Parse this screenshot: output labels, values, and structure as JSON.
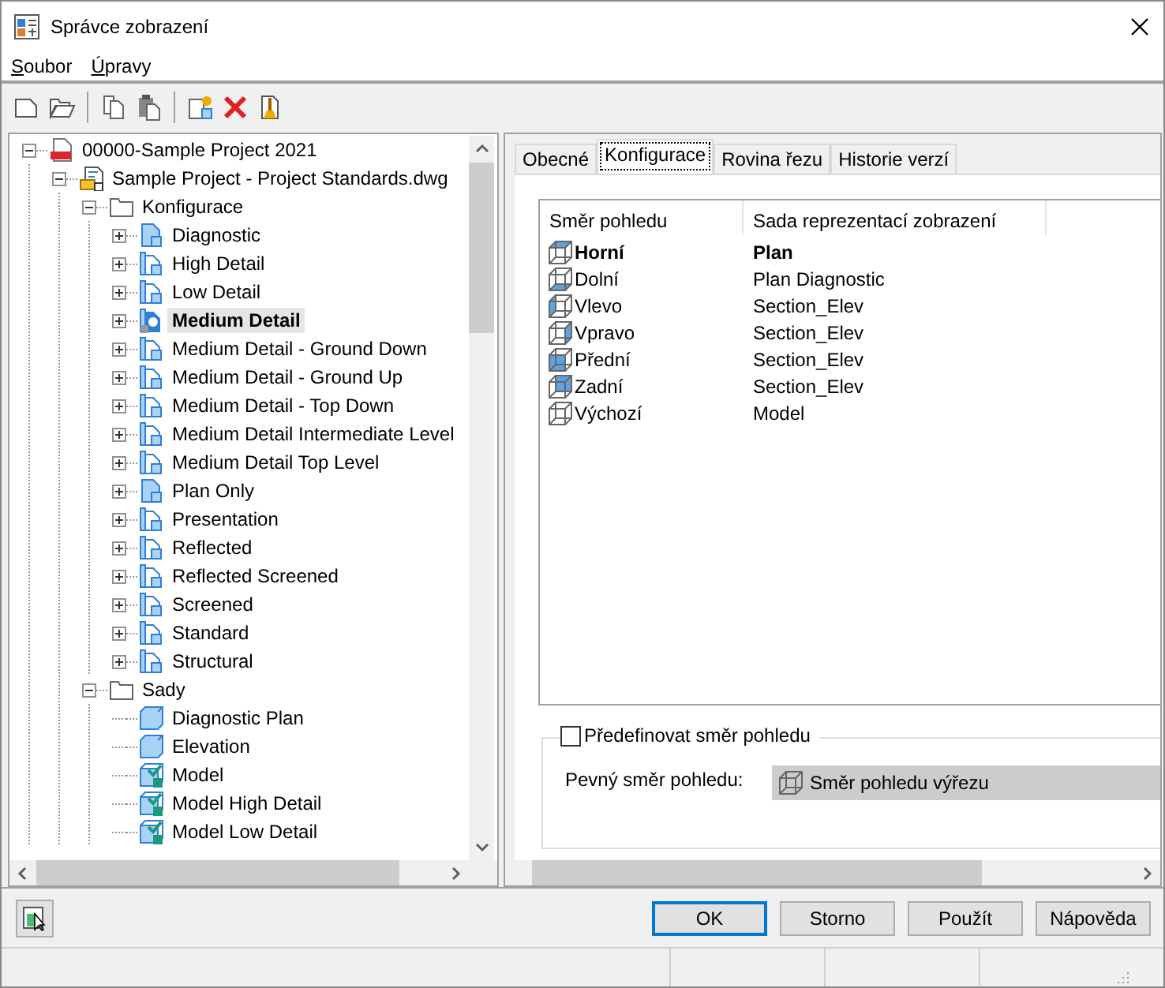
{
  "window": {
    "title": "Správce zobrazení"
  },
  "menu": [
    {
      "label": "Soubor"
    },
    {
      "label": "Úpravy"
    }
  ],
  "tree": [
    {
      "label": "00000-Sample Project 2021",
      "kind": "project",
      "expanded": true,
      "selected": false,
      "children": [
        {
          "label": "Sample Project - Project Standards.dwg",
          "kind": "drawing",
          "expanded": true,
          "selected": false,
          "children": [
            {
              "label": "Konfigurace",
              "kind": "folder",
              "expanded": true,
              "selected": false,
              "children": [
                {
                  "label": "Diagnostic",
                  "kind": "config-plain",
                  "expanded": false,
                  "selected": false
                },
                {
                  "label": "High Detail",
                  "kind": "config",
                  "expanded": false,
                  "selected": false
                },
                {
                  "label": "Low Detail",
                  "kind": "config",
                  "expanded": false,
                  "selected": false
                },
                {
                  "label": "Medium Detail",
                  "kind": "config-active",
                  "expanded": false,
                  "selected": true
                },
                {
                  "label": "Medium Detail - Ground Down",
                  "kind": "config",
                  "expanded": false,
                  "selected": false
                },
                {
                  "label": "Medium Detail - Ground Up",
                  "kind": "config",
                  "expanded": false,
                  "selected": false
                },
                {
                  "label": "Medium Detail - Top Down",
                  "kind": "config",
                  "expanded": false,
                  "selected": false
                },
                {
                  "label": "Medium Detail Intermediate Level",
                  "kind": "config",
                  "expanded": false,
                  "selected": false
                },
                {
                  "label": "Medium Detail Top Level",
                  "kind": "config",
                  "expanded": false,
                  "selected": false
                },
                {
                  "label": "Plan Only",
                  "kind": "config-plain",
                  "expanded": false,
                  "selected": false
                },
                {
                  "label": "Presentation",
                  "kind": "config",
                  "expanded": false,
                  "selected": false
                },
                {
                  "label": "Reflected",
                  "kind": "config",
                  "expanded": false,
                  "selected": false
                },
                {
                  "label": "Reflected Screened",
                  "kind": "config",
                  "expanded": false,
                  "selected": false
                },
                {
                  "label": "Screened",
                  "kind": "config",
                  "expanded": false,
                  "selected": false
                },
                {
                  "label": "Standard",
                  "kind": "config",
                  "expanded": false,
                  "selected": false
                },
                {
                  "label": "Structural",
                  "kind": "config",
                  "expanded": false,
                  "selected": false
                }
              ]
            },
            {
              "label": "Sady",
              "kind": "folder",
              "expanded": true,
              "selected": false,
              "children": [
                {
                  "label": "Diagnostic Plan",
                  "kind": "set",
                  "selected": false
                },
                {
                  "label": "Elevation",
                  "kind": "set",
                  "selected": false
                },
                {
                  "label": "Model",
                  "kind": "set-checked",
                  "selected": false
                },
                {
                  "label": "Model High Detail",
                  "kind": "set-checked",
                  "selected": false
                },
                {
                  "label": "Model Low Detail",
                  "kind": "set-checked",
                  "selected": false
                }
              ]
            }
          ]
        }
      ]
    }
  ],
  "tabs": [
    {
      "label": "Obecné",
      "selected": false
    },
    {
      "label": "Konfigurace",
      "selected": true
    },
    {
      "label": "Rovina řezu",
      "selected": false
    },
    {
      "label": "Historie verzí",
      "selected": false
    }
  ],
  "view_table": {
    "columns": [
      "Směr pohledu",
      "Sada reprezentací zobrazení"
    ],
    "rows": [
      {
        "direction": "Horní",
        "set": "Plan",
        "kind": "top",
        "bold": true
      },
      {
        "direction": "Dolní",
        "set": "Plan Diagnostic",
        "kind": "bottom",
        "bold": false
      },
      {
        "direction": "Vlevo",
        "set": "Section_Elev",
        "kind": "left",
        "bold": false
      },
      {
        "direction": "Vpravo",
        "set": "Section_Elev",
        "kind": "right",
        "bold": false
      },
      {
        "direction": "Přední",
        "set": "Section_Elev",
        "kind": "front",
        "bold": false
      },
      {
        "direction": "Zadní",
        "set": "Section_Elev",
        "kind": "back",
        "bold": false
      },
      {
        "direction": "Výchozí",
        "set": "Model",
        "kind": "none",
        "bold": false
      }
    ]
  },
  "override": {
    "label": "Předefinovat směr pohledu",
    "checked": false
  },
  "fixed_direction": {
    "label": "Pevný směr pohledu:",
    "value": "Směr pohledu výřezu"
  },
  "buttons": [
    {
      "label": "OK",
      "default": true
    },
    {
      "label": "Storno",
      "default": false
    },
    {
      "label": "Použít",
      "default": false
    },
    {
      "label": "Nápověda",
      "default": false
    }
  ]
}
